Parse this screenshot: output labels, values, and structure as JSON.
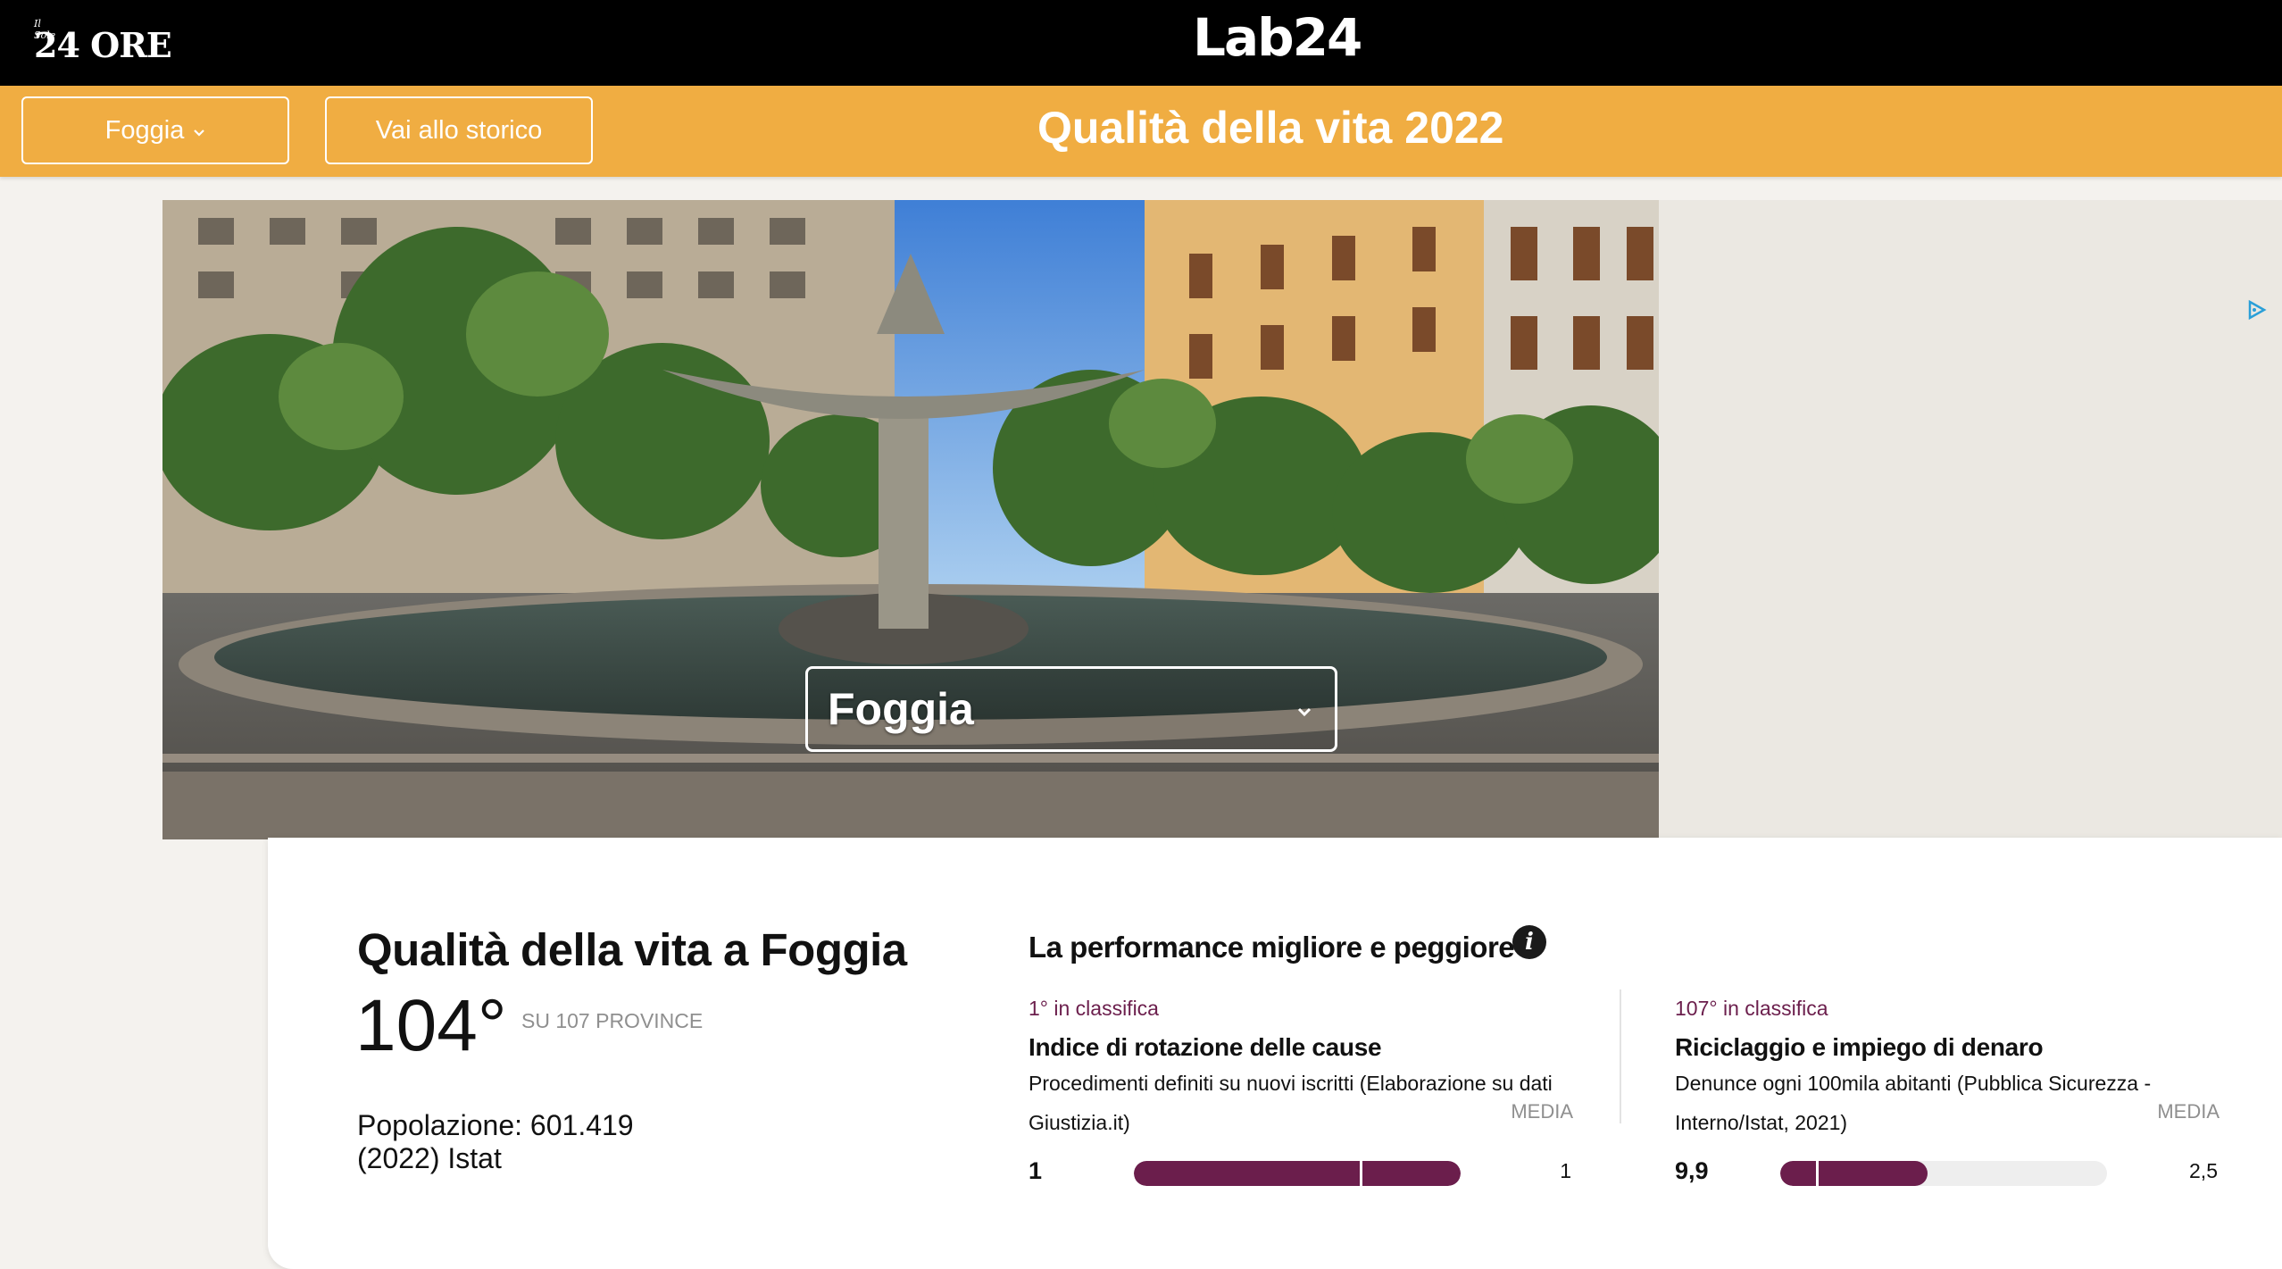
{
  "header": {
    "sole_small": "Il Sole",
    "sole_big": "24 ORE",
    "lab_logo": "Lab24"
  },
  "toolbar": {
    "city_label": "Foggia",
    "history_label": "Vai allo storico",
    "page_title": "Qualità della vita 2022"
  },
  "hero": {
    "select_value": "Foggia"
  },
  "summary": {
    "title": "Qualità della vita a Foggia",
    "rank": "104°",
    "rank_sub": "SU 107 PROVINCE",
    "population_line1": "Popolazione: 601.419",
    "population_line2": "(2022) Istat"
  },
  "performance": {
    "title": "La performance migliore e peggiore",
    "best": {
      "rank": "1° in classifica",
      "name": "Indice di rotazione delle cause",
      "desc": "Procedimenti definiti su nuovi iscritti (Elaborazione su dati Giustizia.it)",
      "media_label": "MEDIA",
      "value": "1",
      "media_value": "1",
      "fill_fraction": 1.0,
      "marker_fraction": 0.69
    },
    "worst": {
      "rank": "107° in classifica",
      "name": "Riciclaggio e impiego di denaro",
      "desc": "Denunce ogni 100mila abitanti (Pubblica Sicurezza - Interno/Istat, 2021)",
      "media_label": "MEDIA",
      "value": "9,9",
      "media_value": "2,5",
      "fill_fraction": 0.45,
      "marker_fraction": 0.11
    }
  },
  "colors": {
    "accent_orange": "#f0ad42",
    "bar_purple": "#6b1e4c"
  }
}
